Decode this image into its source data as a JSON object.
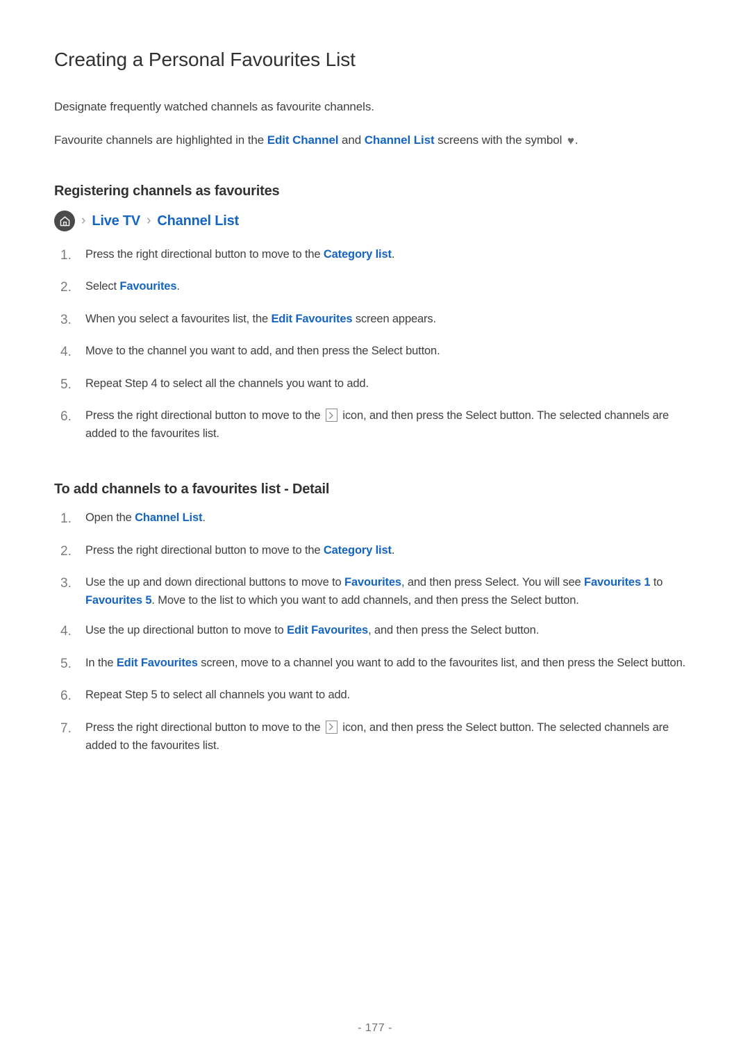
{
  "document": {
    "title": "Creating a Personal Favourites List",
    "intro_1": "Designate frequently watched channels as favourite channels.",
    "intro_2": {
      "part_1": "Favourite channels are highlighted in the ",
      "link_1": "Edit Channel",
      "part_2": " and ",
      "link_2": "Channel List",
      "part_3": " screens with the symbol ",
      "heart_symbol": "♥",
      "part_4": "."
    }
  },
  "section_1": {
    "heading": "Registering channels as favourites",
    "breadcrumb": {
      "home_icon": "home-icon",
      "separator": "›",
      "item_1": "Live TV",
      "item_2": "Channel List"
    },
    "steps": [
      {
        "num": "1.",
        "segments": [
          {
            "type": "text",
            "value": "Press the right directional button to move to the "
          },
          {
            "type": "link",
            "value": "Category list"
          },
          {
            "type": "text",
            "value": "."
          }
        ]
      },
      {
        "num": "2.",
        "segments": [
          {
            "type": "text",
            "value": "Select "
          },
          {
            "type": "link",
            "value": "Favourites"
          },
          {
            "type": "text",
            "value": "."
          }
        ]
      },
      {
        "num": "3.",
        "segments": [
          {
            "type": "text",
            "value": "When you select a favourites list, the "
          },
          {
            "type": "link",
            "value": "Edit Favourites"
          },
          {
            "type": "text",
            "value": " screen appears."
          }
        ]
      },
      {
        "num": "4.",
        "segments": [
          {
            "type": "text",
            "value": "Move to the channel you want to add, and then press the Select button."
          }
        ]
      },
      {
        "num": "5.",
        "segments": [
          {
            "type": "text",
            "value": "Repeat Step 4 to select all the channels you want to add."
          }
        ]
      },
      {
        "num": "6.",
        "segments": [
          {
            "type": "text",
            "value": "Press the right directional button to move to the "
          },
          {
            "type": "boxicon",
            "value": "chevron-right-boxed-icon"
          },
          {
            "type": "text",
            "value": " icon, and then press the Select button. The selected channels are added to the favourites list."
          }
        ]
      }
    ]
  },
  "section_2": {
    "heading": "To add channels to a favourites list - Detail",
    "steps": [
      {
        "num": "1.",
        "segments": [
          {
            "type": "text",
            "value": "Open the "
          },
          {
            "type": "link",
            "value": "Channel List"
          },
          {
            "type": "text",
            "value": "."
          }
        ]
      },
      {
        "num": "2.",
        "segments": [
          {
            "type": "text",
            "value": "Press the right directional button to move to the "
          },
          {
            "type": "link",
            "value": "Category list"
          },
          {
            "type": "text",
            "value": "."
          }
        ]
      },
      {
        "num": "3.",
        "segments": [
          {
            "type": "text",
            "value": "Use the up and down directional buttons to move to "
          },
          {
            "type": "link",
            "value": "Favourites"
          },
          {
            "type": "text",
            "value": ", and then press Select. You will see "
          },
          {
            "type": "link",
            "value": "Favourites 1"
          },
          {
            "type": "text",
            "value": " to "
          },
          {
            "type": "link",
            "value": "Favourites 5"
          },
          {
            "type": "text",
            "value": ". Move to the list to which you want to add channels, and then press the Select button."
          }
        ]
      },
      {
        "num": "4.",
        "segments": [
          {
            "type": "text",
            "value": "Use the up directional button to move to "
          },
          {
            "type": "link",
            "value": "Edit Favourites"
          },
          {
            "type": "text",
            "value": ", and then press the Select button."
          }
        ]
      },
      {
        "num": "5.",
        "segments": [
          {
            "type": "text",
            "value": "In the "
          },
          {
            "type": "link",
            "value": "Edit Favourites"
          },
          {
            "type": "text",
            "value": " screen, move to a channel you want to add to the favourites list, and then press the Select button."
          }
        ]
      },
      {
        "num": "6.",
        "segments": [
          {
            "type": "text",
            "value": "Repeat Step 5 to select all channels you want to add."
          }
        ]
      },
      {
        "num": "7.",
        "segments": [
          {
            "type": "text",
            "value": "Press the right directional button to move to the "
          },
          {
            "type": "boxicon",
            "value": "chevron-right-boxed-icon"
          },
          {
            "type": "text",
            "value": " icon, and then press the Select button. The selected channels are added to the favourites list."
          }
        ]
      }
    ]
  },
  "footer": {
    "page_number": "- 177 -"
  },
  "colors": {
    "link_blue": "#1565c0",
    "body_text": "#3f3f3f",
    "heading_text": "#33312f",
    "number_gray": "#7b7b7b",
    "home_badge": "#4a4a4a",
    "heart_gray": "#6c6c6c",
    "box_border": "#8d8d8d"
  }
}
